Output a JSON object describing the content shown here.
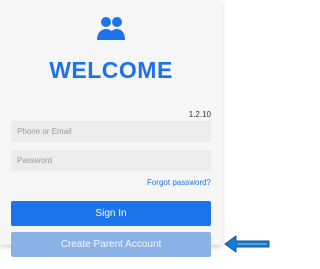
{
  "login": {
    "heading": "WELCOME",
    "version": "1.2.10",
    "phone_placeholder": "Phone or Email",
    "password_placeholder": "Password",
    "forgot_label": "Forgot password?",
    "sign_in_label": "Sign In",
    "create_account_label": "Create Parent Account"
  },
  "icons": {
    "header": "users-icon",
    "pointer": "arrow-left-icon"
  },
  "colors": {
    "accent": "#1d72e8",
    "primary_button": "#1b74ea",
    "secondary_button": "#8ab2e6",
    "arrow": "#1a7bc9"
  }
}
